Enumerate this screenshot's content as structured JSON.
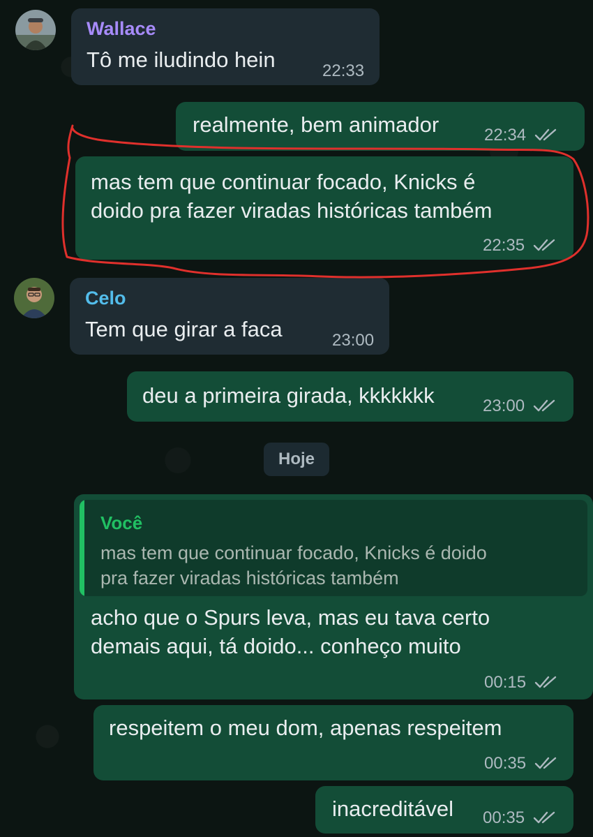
{
  "colors": {
    "incoming_bubble": "#1f2c33",
    "outgoing_bubble": "#134d37",
    "quote_bar": "#21c063",
    "sender_wallace": "#a78bfa",
    "sender_celo": "#53bdeb",
    "annotation_red": "#e0302c"
  },
  "messages": [
    {
      "sender": "Wallace",
      "text": "Tô me iludindo hein",
      "time": "22:33"
    },
    {
      "text": "realmente, bem animador",
      "time": "22:34"
    },
    {
      "text_lines": [
        "mas tem que continuar focado, Knicks é",
        "doido pra fazer viradas históricas também"
      ],
      "time": "22:35"
    },
    {
      "sender": "Celo",
      "text": "Tem que girar a faca",
      "time": "23:00"
    },
    {
      "text": "deu a primeira girada, kkkkkkk",
      "time": "23:00"
    },
    {
      "quote": {
        "sender": "Você",
        "text_lines": [
          "mas tem que continuar focado, Knicks é doido",
          "pra fazer viradas históricas também"
        ]
      },
      "text_lines": [
        "acho que o Spurs leva, mas eu tava certo",
        "demais aqui, tá doido... conheço muito"
      ],
      "time": "00:15"
    },
    {
      "text": "respeitem o meu dom, apenas respeitem",
      "time": "00:35"
    },
    {
      "text": "inacreditável",
      "time": "00:35"
    }
  ],
  "day_separator": "Hoje",
  "icons": {
    "read_receipt": "double-check-icon",
    "avatar_wallace": "avatar-wallace",
    "avatar_celo": "avatar-celo"
  }
}
